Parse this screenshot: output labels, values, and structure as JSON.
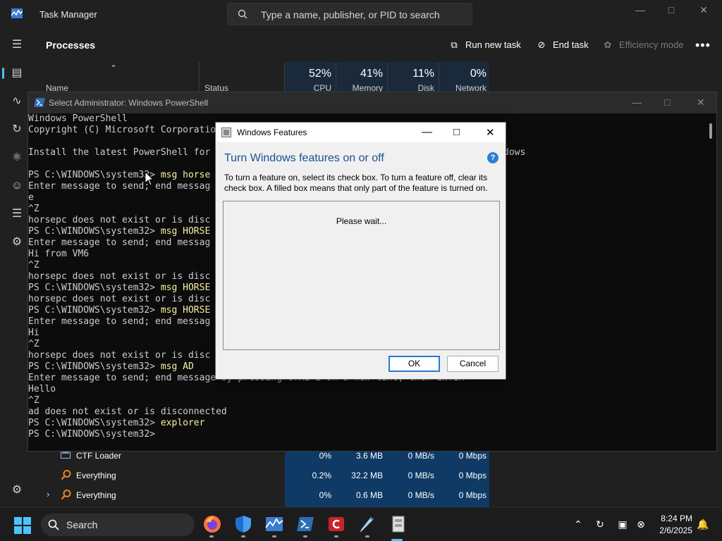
{
  "task_manager": {
    "title": "Task Manager",
    "search_placeholder": "Type a name, publisher, or PID to search",
    "page_heading": "Processes",
    "commands": {
      "run_new_task": "Run new task",
      "end_task": "End task",
      "efficiency_mode": "Efficiency mode"
    },
    "columns": {
      "name": "Name",
      "status": "Status",
      "cpu_pct": "52%",
      "cpu": "CPU",
      "memory_pct": "41%",
      "memory": "Memory",
      "disk_pct": "11%",
      "disk": "Disk",
      "network_pct": "0%",
      "network": "Network"
    },
    "rows": [
      {
        "name": "CTF Loader",
        "cpu": "0%",
        "memory": "3.6 MB",
        "disk": "0 MB/s",
        "network": "0 Mbps"
      },
      {
        "name": "Everything",
        "cpu": "0.2%",
        "memory": "32.2 MB",
        "disk": "0 MB/s",
        "network": "0 Mbps"
      },
      {
        "name": "Everything",
        "cpu": "0%",
        "memory": "0.6 MB",
        "disk": "0 MB/s",
        "network": "0 Mbps"
      }
    ]
  },
  "powershell": {
    "title": "Select Administrator: Windows PowerShell",
    "lines": [
      "Windows PowerShell",
      "Copyright (C) Microsoft Corporatio",
      "",
      "Install the latest PowerShell for",
      "",
      "PS C:\\WINDOWS\\system32> ",
      "Enter message to send; end messag",
      "e",
      "^Z",
      "horsepc does not exist or is disc",
      "PS C:\\WINDOWS\\system32> ",
      "Enter message to send; end messag",
      "Hi from VM6",
      "^Z",
      "horsepc does not exist or is disc",
      "PS C:\\WINDOWS\\system32> ",
      "horsepc does not exist or is disc",
      "PS C:\\WINDOWS\\system32> ",
      "Enter message to send; end messag",
      "Hi",
      "^Z",
      "horsepc does not exist or is disc",
      "PS C:\\WINDOWS\\system32> ",
      "Enter message to send; end message by pressing CTRL-Z on a new line, then ENTER",
      "Hello",
      "^Z",
      "ad does not exist or is disconnected",
      "PS C:\\WINDOWS\\system32> ",
      "PS C:\\WINDOWS\\system32> "
    ],
    "commands": [
      "msg horse",
      "msg HORSE",
      "msg HORSE",
      "msg HORSE",
      "msg AD",
      "explorer"
    ],
    "right_tail": "dows"
  },
  "windows_features": {
    "title": "Windows Features",
    "heading": "Turn Windows features on or off",
    "description": "To turn a feature on, select its check box. To turn a feature off, clear its check box. A filled box means that only part of the feature is turned on.",
    "loading_text": "Please wait...",
    "ok_label": "OK",
    "cancel_label": "Cancel",
    "help_icon": "?"
  },
  "taskbar": {
    "search_label": "Search",
    "time": "8:24 PM",
    "date": "2/6/2025"
  },
  "colors": {
    "accent": "#4cc2ff",
    "highlight_column": "#0f3a66",
    "dialog_heading": "#1d4f91"
  }
}
